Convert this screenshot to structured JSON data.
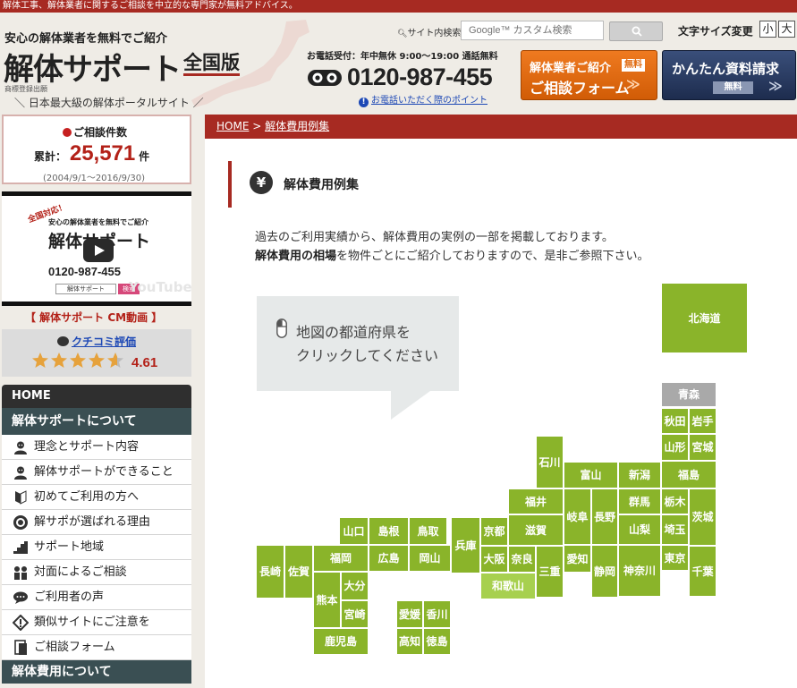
{
  "top_strip": "解体工事、解体業者に関するご相談を中立的な専門家が無料アドバイス。",
  "header": {
    "tagline": "安心の解体業者を無料でご紹介",
    "logo": "解体サポート",
    "logo_sub": "全国版",
    "trademark": "商標登録出願",
    "portal_tag": "＼ 日本最大級の解体ポータルサイト ／",
    "search_label": "サイト内検索",
    "search_placeholder": "Google™ カスタム検索",
    "fontsize_label": "文字サイズ変更",
    "fontsize_small": "小",
    "fontsize_large": "大",
    "tel_hours": "お電話受付：年中無休 9:00～19:00 通話無料",
    "tel_number": "0120-987-455",
    "tel_point": "お電話いただく際のポイント",
    "cta_form_line1": "解体業者ご紹介",
    "cta_form_badge": "無料",
    "cta_form_line2": "ご相談フォーム",
    "cta_doc_line1": "かんたん資料請求",
    "cta_doc_badge": "無料",
    "arrows": "≫"
  },
  "sidebar": {
    "count_title": "ご相談件数",
    "count_label": "累計：",
    "count_value": "25,571",
    "count_unit": "件",
    "count_period": "(2004/9/1～2016/9/30)",
    "cm_ribbon": "全国対応！",
    "cm_tag": "安心の解体業者を無料でご紹介",
    "cm_logo": "解体サポート",
    "cm_tel": "0120-987-455",
    "cm_bar": "解体サポート",
    "cm_bar2": "検索",
    "cm_youtube": "YouTube",
    "cm_caption": "【 解体サポート CM動画 】",
    "review_link": "クチコミ評価",
    "review_score": "4.61",
    "review_rating": 4.61,
    "nav_home": "HOME",
    "nav_section1": "解体サポートについて",
    "nav_items": [
      {
        "label": "理念とサポート内容",
        "icon": "person-icon"
      },
      {
        "label": "解体サポートができること",
        "icon": "person-icon"
      },
      {
        "label": "初めてご利用の方へ",
        "icon": "beginner-mark-icon"
      },
      {
        "label": "解サポが選ばれる理由",
        "icon": "medal-icon"
      },
      {
        "label": "サポート地域",
        "icon": "stairs-icon"
      },
      {
        "label": "対面によるご相談",
        "icon": "people-icon"
      },
      {
        "label": "ご利用者の声",
        "icon": "speech-bubble-icon"
      },
      {
        "label": "類似サイトにご注意を",
        "icon": "warning-icon"
      },
      {
        "label": "ご相談フォーム",
        "icon": "form-icon"
      }
    ],
    "nav_section2": "解体費用について"
  },
  "main": {
    "breadcrumb_home": "HOME",
    "breadcrumb_sep": " > ",
    "breadcrumb_current": "解体費用例集",
    "section_icon": "¥",
    "section_title": "解体費用例集",
    "intro1": "過去のご利用実績から、解体費用の実例の一部を掲載しております。",
    "intro2_bold": "解体費用の相場",
    "intro2_rest": "を物件ごとにご紹介しておりますので、是非ご参照下さい。",
    "balloon_l1": "地図の都道府県を",
    "balloon_l2": "クリックしてください"
  },
  "prefectures": {
    "hokkaido": "北海道",
    "aomori": "青森",
    "akita": "秋田",
    "iwate": "岩手",
    "yamagata": "山形",
    "miyagi": "宮城",
    "ishikawa": "石川",
    "toyama": "富山",
    "niigata": "新潟",
    "fukushima": "福島",
    "fukui": "福井",
    "gifu": "岐阜",
    "nagano": "長野",
    "gunma": "群馬",
    "tochigi": "栃木",
    "ibaraki": "茨城",
    "yamaguchi": "山口",
    "shimane": "島根",
    "tottori": "鳥取",
    "hyogo": "兵庫",
    "kyoto": "京都",
    "shiga": "滋賀",
    "yamanashi": "山梨",
    "saitama": "埼玉",
    "nagasaki": "長崎",
    "saga": "佐賀",
    "fukuoka": "福岡",
    "hiroshima": "広島",
    "okayama": "岡山",
    "osaka": "大阪",
    "nara": "奈良",
    "mie": "三重",
    "aichi": "愛知",
    "shizuoka": "静岡",
    "kanagawa": "神奈川",
    "tokyo": "東京",
    "chiba": "千葉",
    "kumamoto": "熊本",
    "oita": "大分",
    "miyazaki": "宮崎",
    "wakayama": "和歌山",
    "ehime": "愛媛",
    "kagawa": "香川",
    "kochi": "高知",
    "tokushima": "徳島",
    "kagoshima": "鹿児島"
  }
}
